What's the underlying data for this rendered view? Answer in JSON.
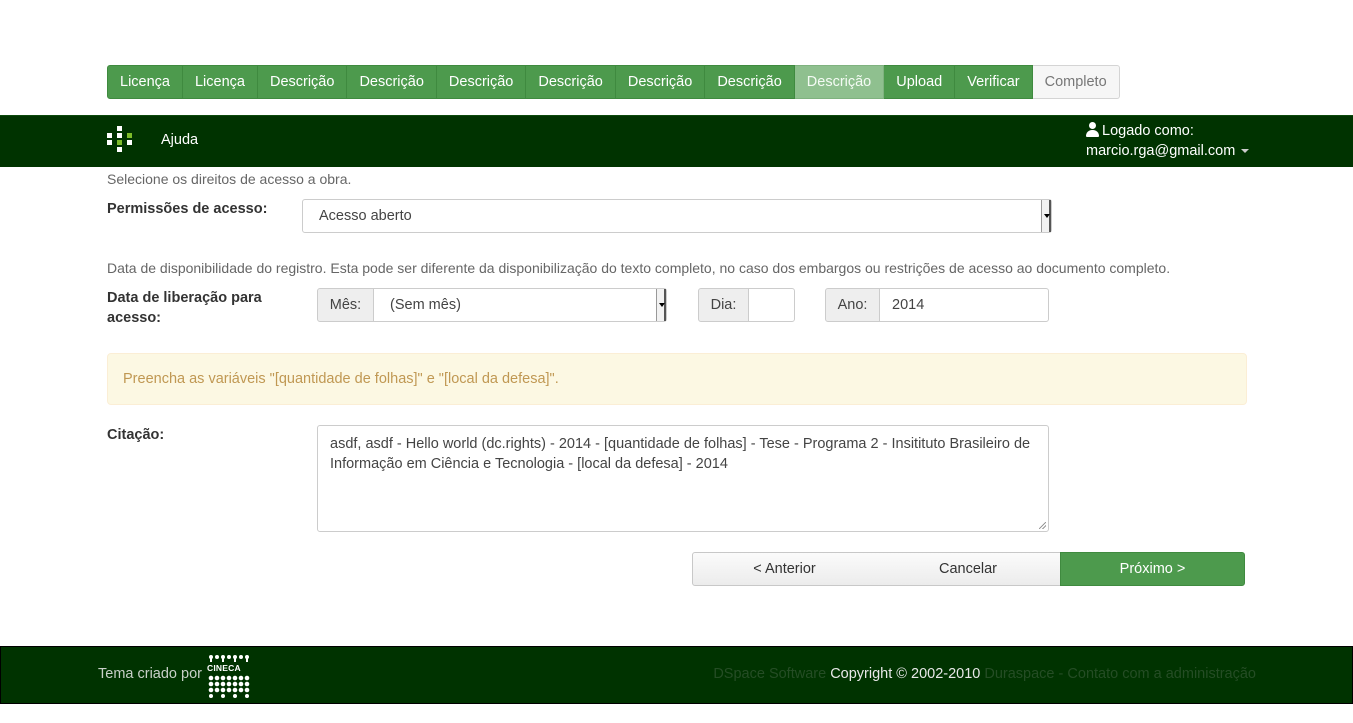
{
  "steps": [
    {
      "label": "Licença",
      "state": "done"
    },
    {
      "label": "Licença",
      "state": "done"
    },
    {
      "label": "Descrição",
      "state": "done"
    },
    {
      "label": "Descrição",
      "state": "done"
    },
    {
      "label": "Descrição",
      "state": "done"
    },
    {
      "label": "Descrição",
      "state": "done"
    },
    {
      "label": "Descrição",
      "state": "done"
    },
    {
      "label": "Descrição",
      "state": "done"
    },
    {
      "label": "Descrição",
      "state": "current"
    },
    {
      "label": "Upload",
      "state": "done"
    },
    {
      "label": "Verificar",
      "state": "done"
    },
    {
      "label": "Completo",
      "state": "future"
    }
  ],
  "navbar": {
    "help": "Ajuda",
    "logged_as": "Logado como:",
    "user_email": "marcio.rga@gmail.com"
  },
  "access": {
    "hint": "Selecione os direitos de acesso a obra.",
    "label": "Permissões de acesso:",
    "selected": "Acesso aberto"
  },
  "release": {
    "hint": "Data de disponibilidade do registro. Esta pode ser diferente da disponibilização do texto completo, no caso dos embargos ou restrições de acesso ao documento completo.",
    "label": "Data de liberação para acesso:",
    "month_label": "Mês:",
    "month_value": "(Sem mês)",
    "day_label": "Dia:",
    "day_value": "",
    "year_label": "Ano:",
    "year_value": "2014"
  },
  "alert": "Preencha as variáveis \"[quantidade de folhas]\" e \"[local da defesa]\".",
  "citation": {
    "label": "Citação:",
    "value": "asdf, asdf - Hello world (dc.rights) - 2014 - [quantidade de folhas] - Tese - Programa 2 - Insitituto Brasileiro de Informação em Ciência e Tecnologia - [local da defesa] - 2014"
  },
  "buttons": {
    "previous": "< Anterior",
    "cancel": "Cancelar",
    "next": "Próximo >"
  },
  "footer": {
    "theme_by": "Tema criado por",
    "cineca_text": "CINECA",
    "dspace": "DSpace Software",
    "copyright": "Copyright © 2002-2010",
    "duraspace": "Duraspace",
    "separator": "-",
    "contact": "Contato com a administração"
  },
  "colors": {
    "brand_green": "#4d9a4d",
    "navbar_bg": "#003300",
    "alert_bg": "#fcf8e3",
    "alert_text": "#c09853"
  }
}
